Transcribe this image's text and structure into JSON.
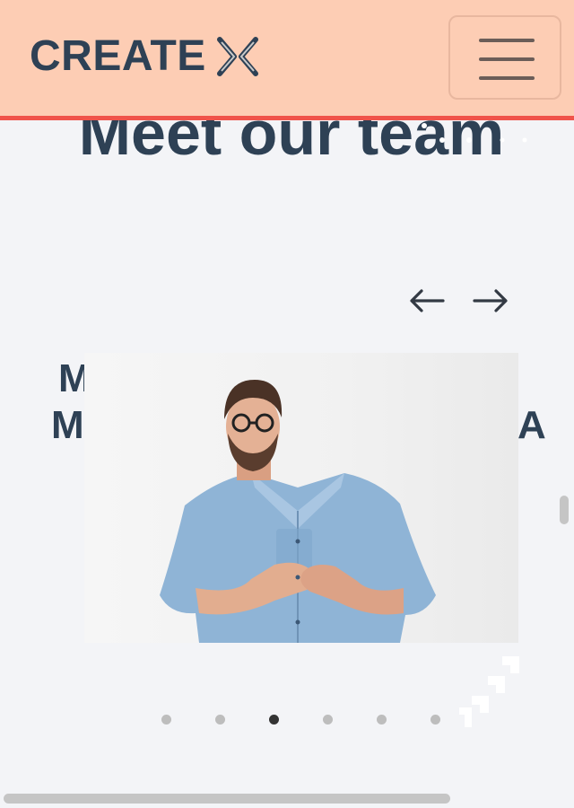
{
  "header": {
    "logo_text": "CREATE",
    "logo_icon": "create-x-mark-icon",
    "menu_icon": "hamburger-menu-icon"
  },
  "main": {
    "heading": "Meet our team",
    "prev_icon": "arrow-left-icon",
    "next_icon": "arrow-right-icon",
    "peek_names": [
      "M",
      "Mc",
      "A"
    ],
    "photo_alt": "team-member-photo",
    "carousel_dots": {
      "count": 6,
      "active_index": 2
    }
  },
  "colors": {
    "header_bg": "#fdcdb4",
    "header_border": "#f0534a",
    "page_bg": "#f3f4f7",
    "text": "#2e4155"
  }
}
